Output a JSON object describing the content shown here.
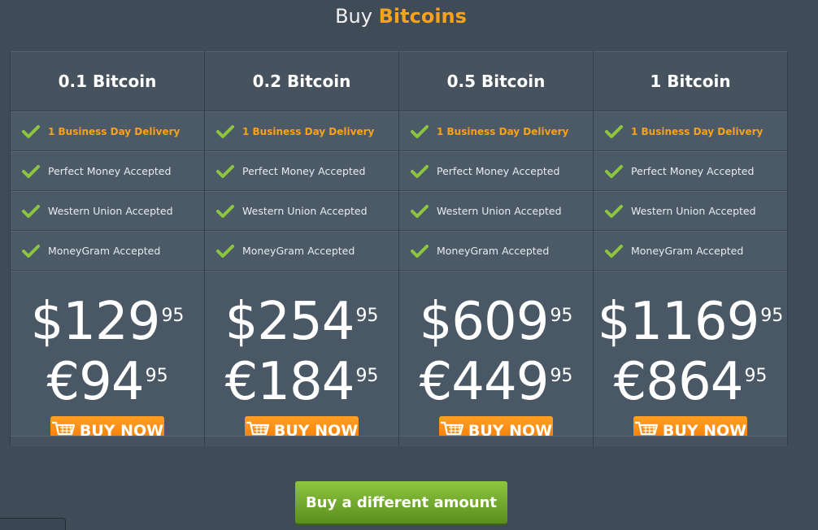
{
  "title": {
    "prefix": "Buy",
    "accent": "Bitcoins"
  },
  "colors": {
    "background": "#3f4b57",
    "accent": "#f7a21b",
    "check": "#8cc63f",
    "buy_button": "#f27400",
    "different_button": "#6ea52b"
  },
  "plans": [
    {
      "name": "0.1 Bitcoin",
      "features": [
        "1 Business Day Delivery",
        "Perfect Money Accepted",
        "Western Union Accepted",
        "MoneyGram Accepted"
      ],
      "usd": {
        "symbol": "$",
        "whole": "129",
        "cents": "95"
      },
      "eur": {
        "symbol": "€",
        "whole": "94",
        "cents": "95"
      },
      "buy_label": "BUY NOW"
    },
    {
      "name": "0.2 Bitcoin",
      "features": [
        "1 Business Day Delivery",
        "Perfect Money Accepted",
        "Western Union Accepted",
        "MoneyGram Accepted"
      ],
      "usd": {
        "symbol": "$",
        "whole": "254",
        "cents": "95"
      },
      "eur": {
        "symbol": "€",
        "whole": "184",
        "cents": "95"
      },
      "buy_label": "BUY NOW"
    },
    {
      "name": "0.5 Bitcoin",
      "features": [
        "1 Business Day Delivery",
        "Perfect Money Accepted",
        "Western Union Accepted",
        "MoneyGram Accepted"
      ],
      "usd": {
        "symbol": "$",
        "whole": "609",
        "cents": "95"
      },
      "eur": {
        "symbol": "€",
        "whole": "449",
        "cents": "95"
      },
      "buy_label": "BUY NOW"
    },
    {
      "name": "1 Bitcoin",
      "features": [
        "1 Business Day Delivery",
        "Perfect Money Accepted",
        "Western Union Accepted",
        "MoneyGram Accepted"
      ],
      "usd": {
        "symbol": "$",
        "whole": "1169",
        "cents": "95"
      },
      "eur": {
        "symbol": "€",
        "whole": "864",
        "cents": "95"
      },
      "buy_label": "BUY NOW"
    }
  ],
  "icons": {
    "feature": "check-icon",
    "buy": "cart-icon"
  },
  "different_amount_label": "Buy a different amount"
}
